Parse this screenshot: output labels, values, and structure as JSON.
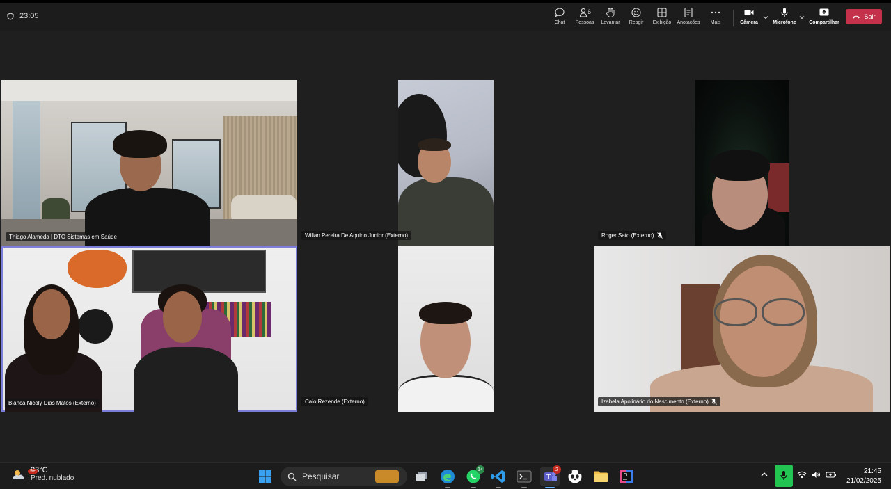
{
  "toolbar": {
    "timer": "23:05",
    "chat": "Chat",
    "people": "Pessoas",
    "people_count": "6",
    "raise": "Levantar",
    "react": "Reagir",
    "view": "Exibição",
    "notes": "Anotações",
    "more": "Mais",
    "camera": "Câmera",
    "mic": "Microfone",
    "share": "Compartilhar",
    "leave": "Sair"
  },
  "participants": [
    {
      "name": "Thiago Alameda | DTO Sistemas em Saúde",
      "muted": false
    },
    {
      "name": "Wilian Pereira De Aquino Junior (Externo)",
      "muted": false
    },
    {
      "name": "Roger Sato (Externo)",
      "muted": true
    },
    {
      "name": "Bianca Nicoly Dias Matos (Externo)",
      "muted": false,
      "active_speaker": true
    },
    {
      "name": "Caio Rezende (Externo)",
      "muted": false
    },
    {
      "name": "Izabela Apolinário do Nascimento (Externo)",
      "muted": true
    }
  ],
  "taskbar": {
    "weather_temp": "23°C",
    "weather_cond": "Pred. nublado",
    "weather_badge": "9+",
    "search_label": "Pesquisar",
    "whatsapp_badge": "14",
    "teams_badge": "2",
    "time": "21:45",
    "date": "21/02/2025"
  },
  "colors": {
    "leave": "#c4314b",
    "speaker_outline": "#7b7fd9",
    "mic_active": "#23c552"
  }
}
